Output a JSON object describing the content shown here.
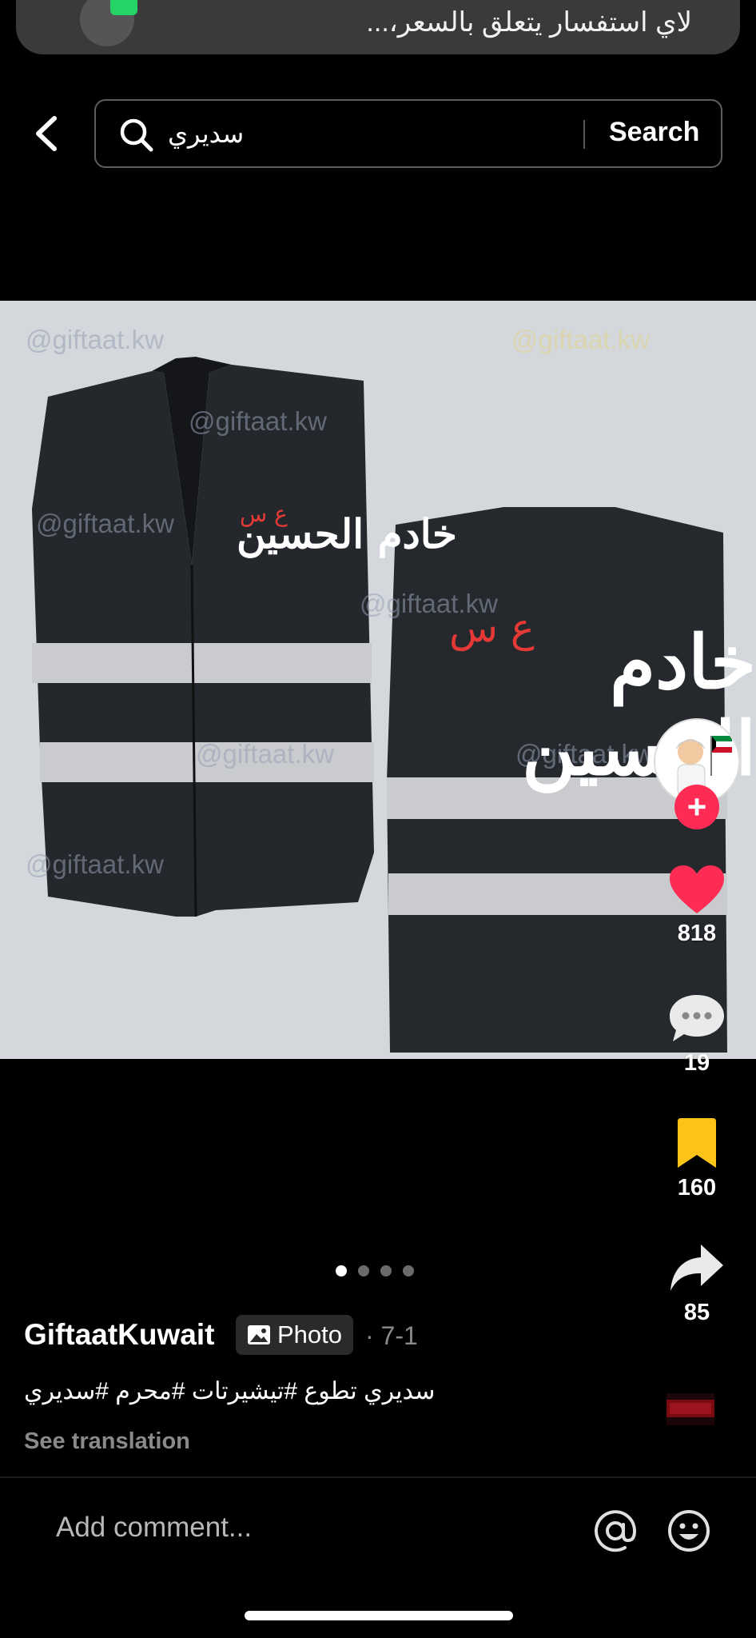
{
  "notification": {
    "text": "لاي استفسار يتعلق بالسعر،..."
  },
  "search": {
    "query": "سديري",
    "button_label": "Search"
  },
  "photo": {
    "watermark": "@giftaat.kw",
    "vest_text_main": "خادم الحسين",
    "vest_text_suffix": "ع س"
  },
  "rail": {
    "likes": "818",
    "comments": "19",
    "saves": "160",
    "shares": "85"
  },
  "carousel": {
    "total": 4,
    "active_index": 0
  },
  "post": {
    "author": "GiftaatKuwait",
    "type_badge": "Photo",
    "date": "· 7-1",
    "caption": "سديري تطوع  #تيشيرتات #محرم #سديري",
    "see_translation": "See translation"
  },
  "comment_bar": {
    "placeholder": "Add comment..."
  },
  "colors": {
    "like": "#fe2c55",
    "save": "#fcc419",
    "follow": "#fe2c55"
  }
}
